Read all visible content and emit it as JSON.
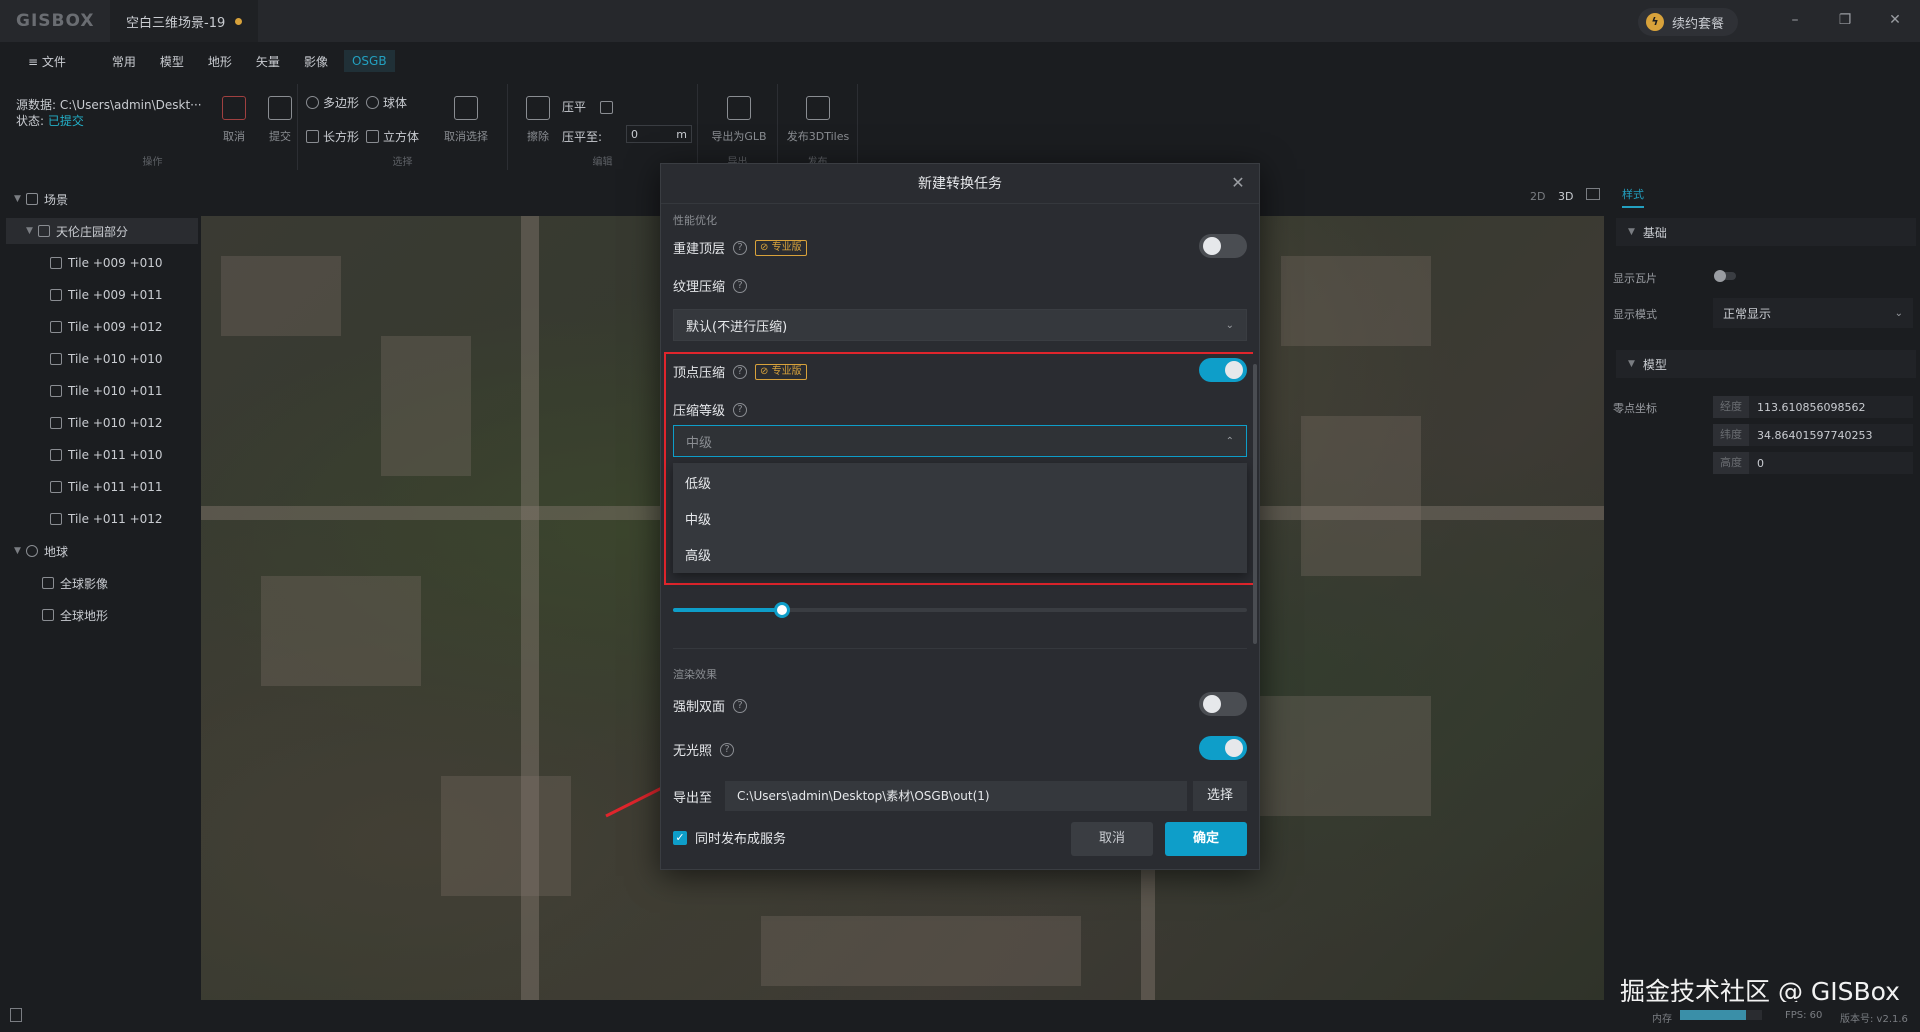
{
  "app": {
    "logo": "GISBOX",
    "doc_tab": "空白三维场景-19",
    "renew_label": "续约套餐",
    "renew_icon": "bolt-icon"
  },
  "menu": {
    "file": "≡ 文件",
    "items": [
      "常用",
      "模型",
      "地形",
      "矢量",
      "影像",
      "OSGB"
    ],
    "active": "OSGB"
  },
  "ribbon": {
    "source_label": "源数据:",
    "source_value": "C:\\Users\\admin\\Deskt···",
    "status_label": "状态:",
    "status_value": "已提交",
    "cancel": "取消",
    "submit": "提交",
    "group_operate": "操作",
    "polygon": "多边形",
    "sphere": "球体",
    "rectangle": "长方形",
    "cube": "立方体",
    "deselect": "取消选择",
    "group_select": "选择",
    "erase": "擦除",
    "flatten": "压平",
    "flatten_to": "压平至:",
    "flatten_value": "0",
    "flatten_unit": "m",
    "group_edit": "编辑",
    "export_glb": "导出为GLB",
    "group_export": "导出",
    "publish_3dtiles": "发布3DTiles",
    "group_publish": "发布"
  },
  "tree": {
    "scene": "场景",
    "group": "天伦庄园部分",
    "tiles": [
      "Tile +009 +010",
      "Tile +009 +011",
      "Tile +009 +012",
      "Tile +010 +010",
      "Tile +010 +011",
      "Tile +010 +012",
      "Tile +011 +010",
      "Tile +011 +011",
      "Tile +011 +012"
    ],
    "earth": "地球",
    "global_imagery": "全球影像",
    "global_terrain": "全球地形"
  },
  "right_panel": {
    "view_2d": "2D",
    "view_3d": "3D",
    "tab": "样式",
    "section_basic": "基础",
    "show_tiles": "显示瓦片",
    "display_mode": "显示模式",
    "display_mode_value": "正常显示",
    "section_model": "模型",
    "origin": "零点坐标",
    "lon_tag": "经度",
    "lon_value": "113.610856098562",
    "lat_tag": "纬度",
    "lat_value": "34.86401597740253",
    "alt_tag": "高度",
    "alt_value": "0"
  },
  "dialog": {
    "title": "新建转换任务",
    "perf_section": "性能优化",
    "rebuild_top": "重建顶层",
    "pro_badge": "专业版",
    "texture_compress": "纹理压缩",
    "texture_value": "默认(不进行压缩)",
    "vertex_compress": "顶点压缩",
    "compress_level": "压缩等级",
    "compress_level_value": "中级",
    "options": [
      "低级",
      "中级",
      "高级"
    ],
    "slider_value": 0.19,
    "render_section": "渲染效果",
    "force_double_side": "强制双面",
    "no_lighting": "无光照",
    "export_to": "导出至",
    "export_path": "C:\\Users\\admin\\Desktop\\素材\\OSGB\\out(1)",
    "choose": "选择",
    "publish_service": "同时发布成服务",
    "cancel": "取消",
    "confirm": "确定",
    "toggles": {
      "rebuild_top": false,
      "vertex_compress": true,
      "force_double_side": false,
      "no_lighting": true
    }
  },
  "status": {
    "memory_label": "内存",
    "memory_fraction": 0.8,
    "fps": "FPS: 60",
    "version": "版本号: v2.1.6"
  },
  "watermark": "掘金技术社区 @ GISBox",
  "colors": {
    "accent": "#0e9ec9",
    "highlight_border": "#e0252c",
    "pro": "#d8a23b"
  }
}
